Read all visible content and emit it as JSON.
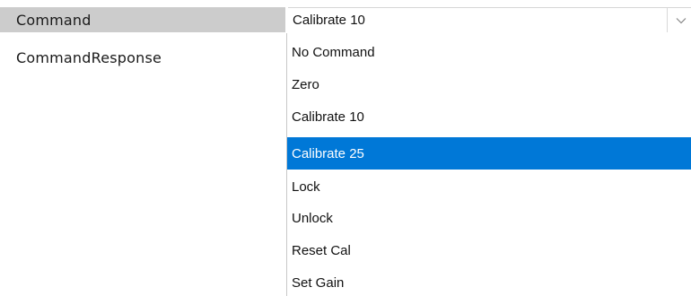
{
  "properties": [
    {
      "name": "Command",
      "selected": true
    },
    {
      "name": "CommandResponse",
      "selected": false
    }
  ],
  "command_combo": {
    "selected_value": "Calibrate 10",
    "arrow_icon": "chevron-down-icon"
  },
  "dropdown": {
    "highlighted": "Calibrate 25",
    "options": [
      "No Command",
      "Zero",
      "Calibrate 10",
      "Calibrate 25",
      "Lock",
      "Unlock",
      "Reset Cal",
      "Set Gain"
    ]
  },
  "colors": {
    "selected_row_bg": "#cccccc",
    "highlight_bg": "#0078d7",
    "highlight_text": "#ffffff"
  }
}
